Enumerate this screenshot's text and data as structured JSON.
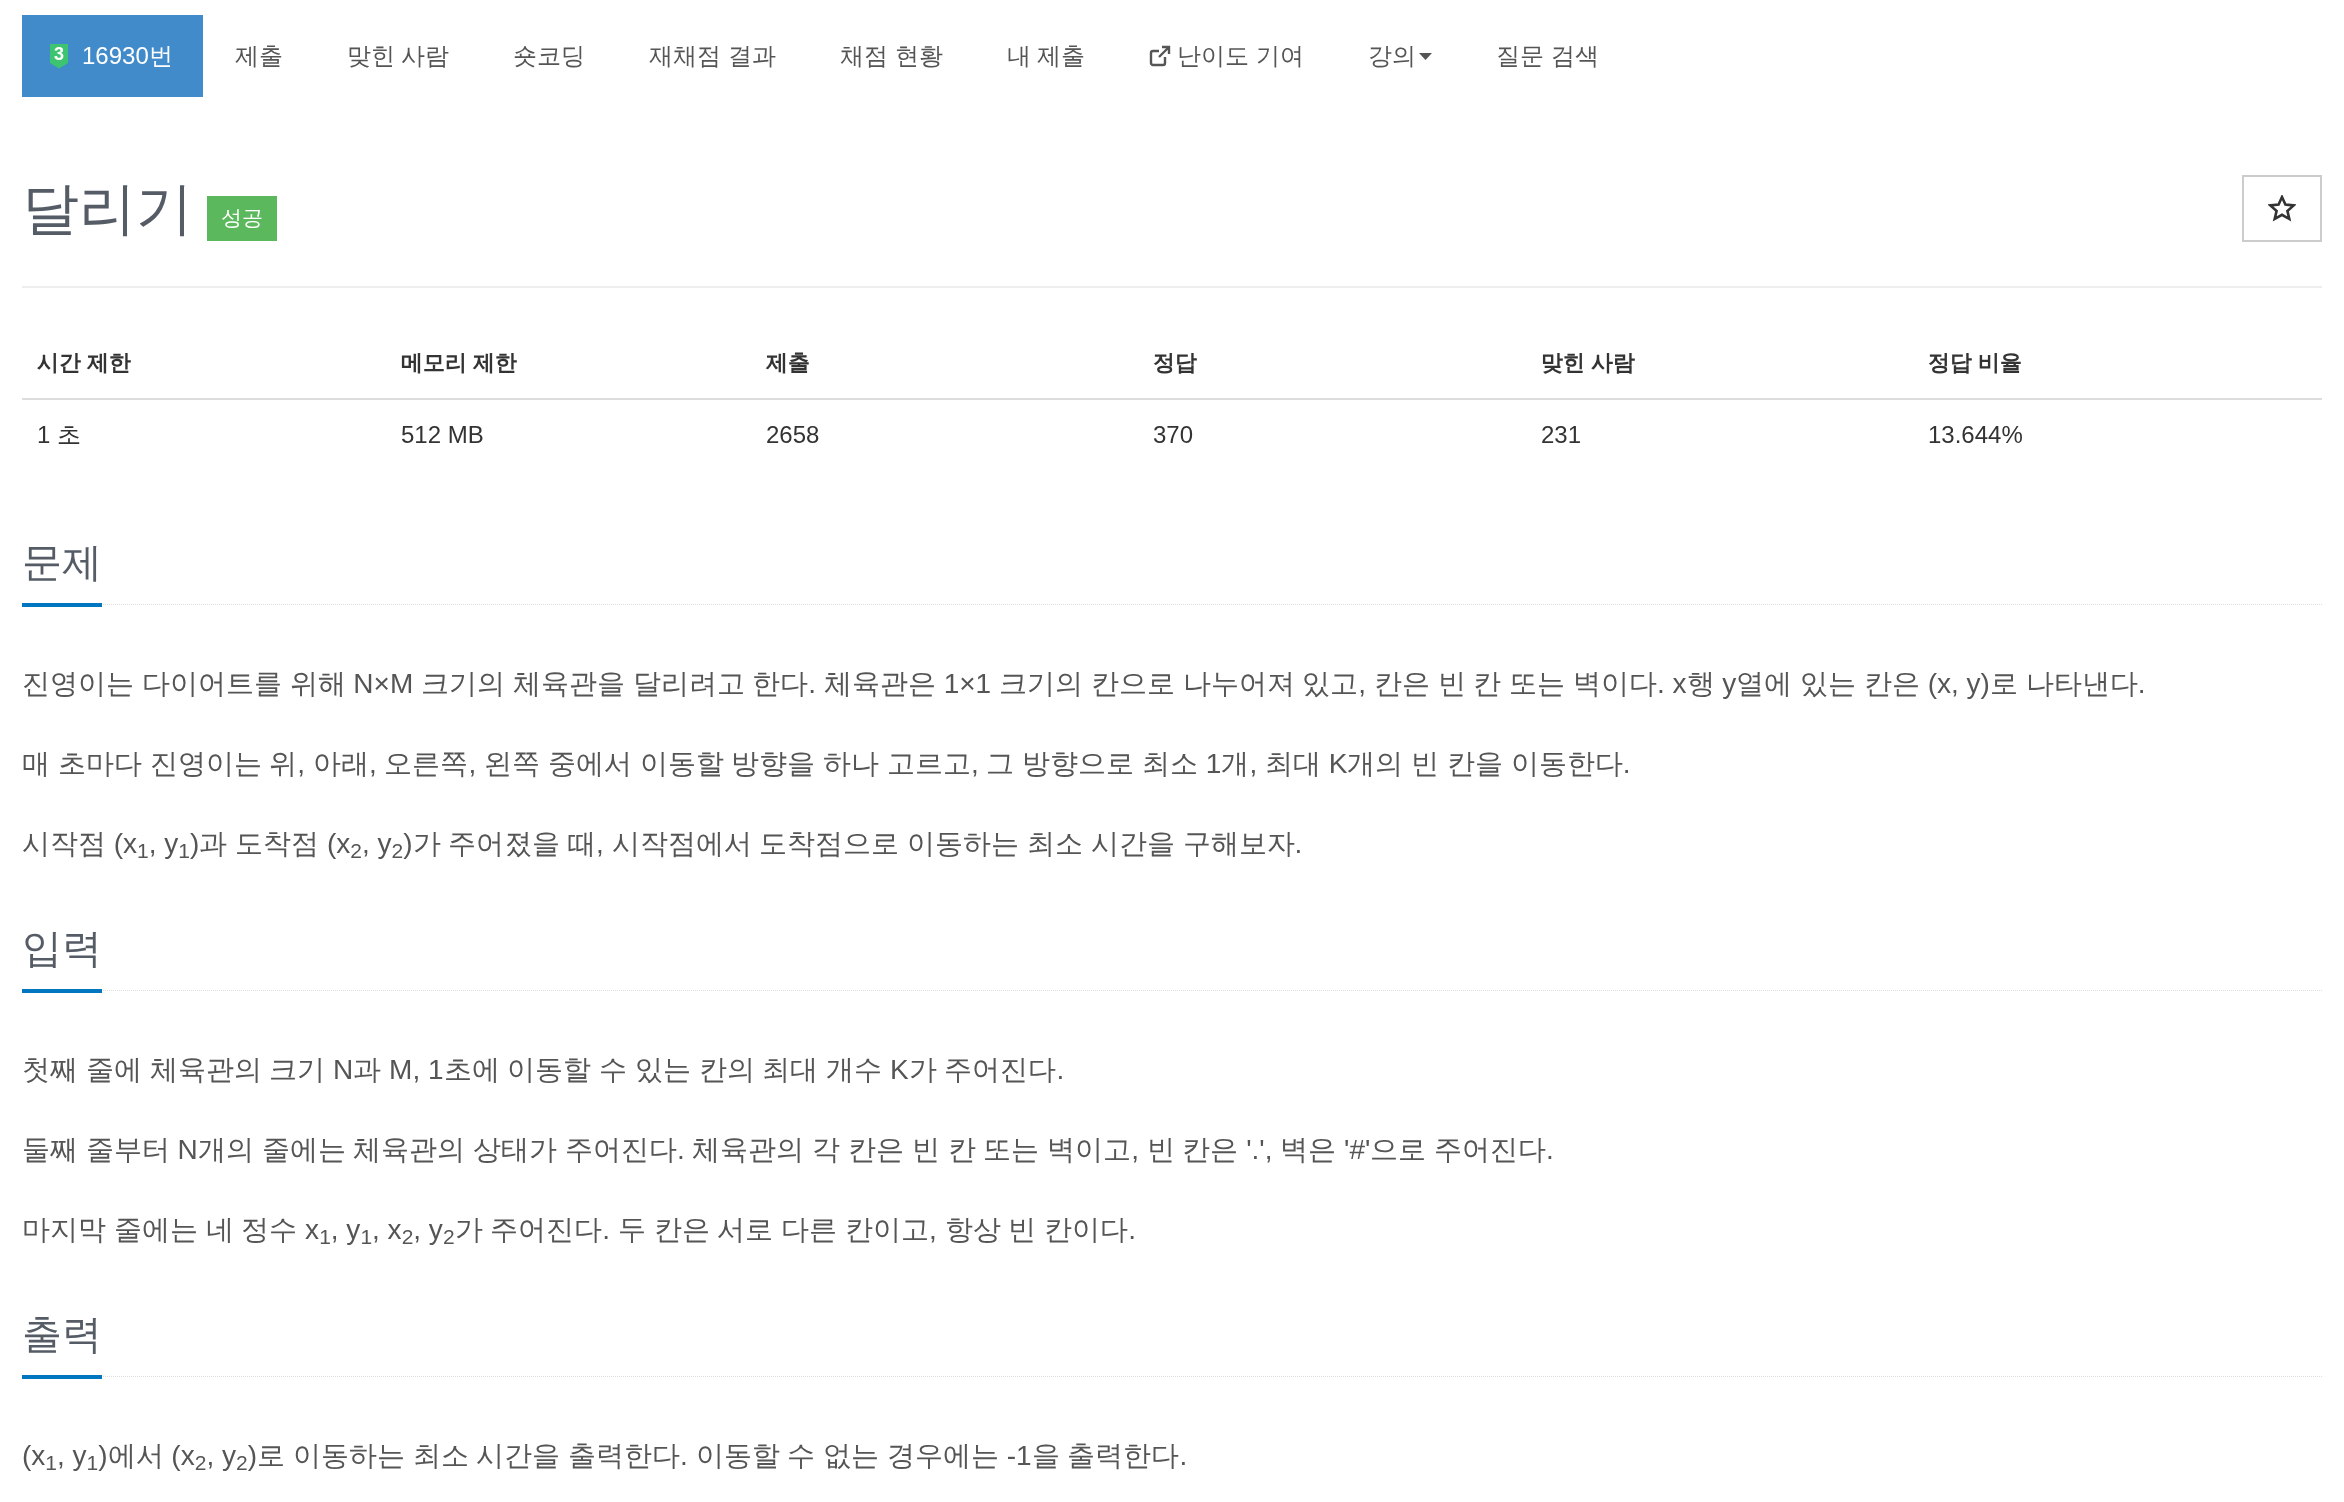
{
  "nav": {
    "tabs": [
      {
        "kind": "problem",
        "tier": "3",
        "label": "16930번",
        "selected": true
      },
      {
        "kind": "link",
        "label": "제출",
        "selected": false
      },
      {
        "kind": "link",
        "label": "맞힌 사람",
        "selected": false
      },
      {
        "kind": "link",
        "label": "숏코딩",
        "selected": false
      },
      {
        "kind": "link",
        "label": "재채점 결과",
        "selected": false
      },
      {
        "kind": "link",
        "label": "채점 현황",
        "selected": false
      },
      {
        "kind": "link",
        "label": "내 제출",
        "selected": false
      },
      {
        "kind": "external",
        "label": "난이도 기여",
        "selected": false
      },
      {
        "kind": "dropdown",
        "label": "강의",
        "selected": false
      },
      {
        "kind": "link",
        "label": "질문 검색",
        "selected": false
      }
    ]
  },
  "problem": {
    "title": "달리기",
    "status": {
      "kind": "success",
      "label": "성공"
    }
  },
  "stats": {
    "columns": [
      "시간 제한",
      "메모리 제한",
      "제출",
      "정답",
      "맞힌 사람",
      "정답 비율"
    ],
    "rows": [
      [
        "1 초",
        "512 MB",
        "2658",
        "370",
        "231",
        "13.644%"
      ]
    ]
  },
  "sections": [
    {
      "title": "문제",
      "paragraphs": [
        "진영이는 다이어트를 위해 N×M 크기의 체육관을 달리려고 한다. 체육관은 1×1 크기의 칸으로 나누어져 있고, 칸은 빈 칸 또는 벽이다. x행 y열에 있는 칸은 (x, y)로 나타낸다.",
        "매 초마다 진영이는 위, 아래, 오른쪽, 왼쪽 중에서 이동할 방향을 하나 고르고, 그 방향으로 최소 1개, 최대 K개의 빈 칸을 이동한다.",
        "시작점 (x$_{1}$, y$_{1}$)과 도착점 (x$_{2}$, y$_{2}$)가 주어졌을 때, 시작점에서 도착점으로 이동하는 최소 시간을 구해보자."
      ]
    },
    {
      "title": "입력",
      "paragraphs": [
        "첫째 줄에 체육관의 크기 N과 M, 1초에 이동할 수 있는 칸의 최대 개수 K가 주어진다.",
        "둘째 줄부터 N개의 줄에는 체육관의 상태가 주어진다. 체육관의 각 칸은 빈 칸 또는 벽이고, 빈 칸은 '.', 벽은 '#'으로 주어진다.",
        "마지막 줄에는 네 정수 x$_{1}$, y$_{1}$, x$_{2}$, y$_{2}$가 주어진다. 두 칸은 서로 다른 칸이고, 항상 빈 칸이다."
      ]
    },
    {
      "title": "출력",
      "paragraphs": [
        "(x$_{1}$, y$_{1}$)에서 (x$_{2}$, y$_{2}$)로 이동하는 최소 시간을 출력한다. 이동할 수 없는 경우에는 -1을 출력한다."
      ]
    }
  ]
}
